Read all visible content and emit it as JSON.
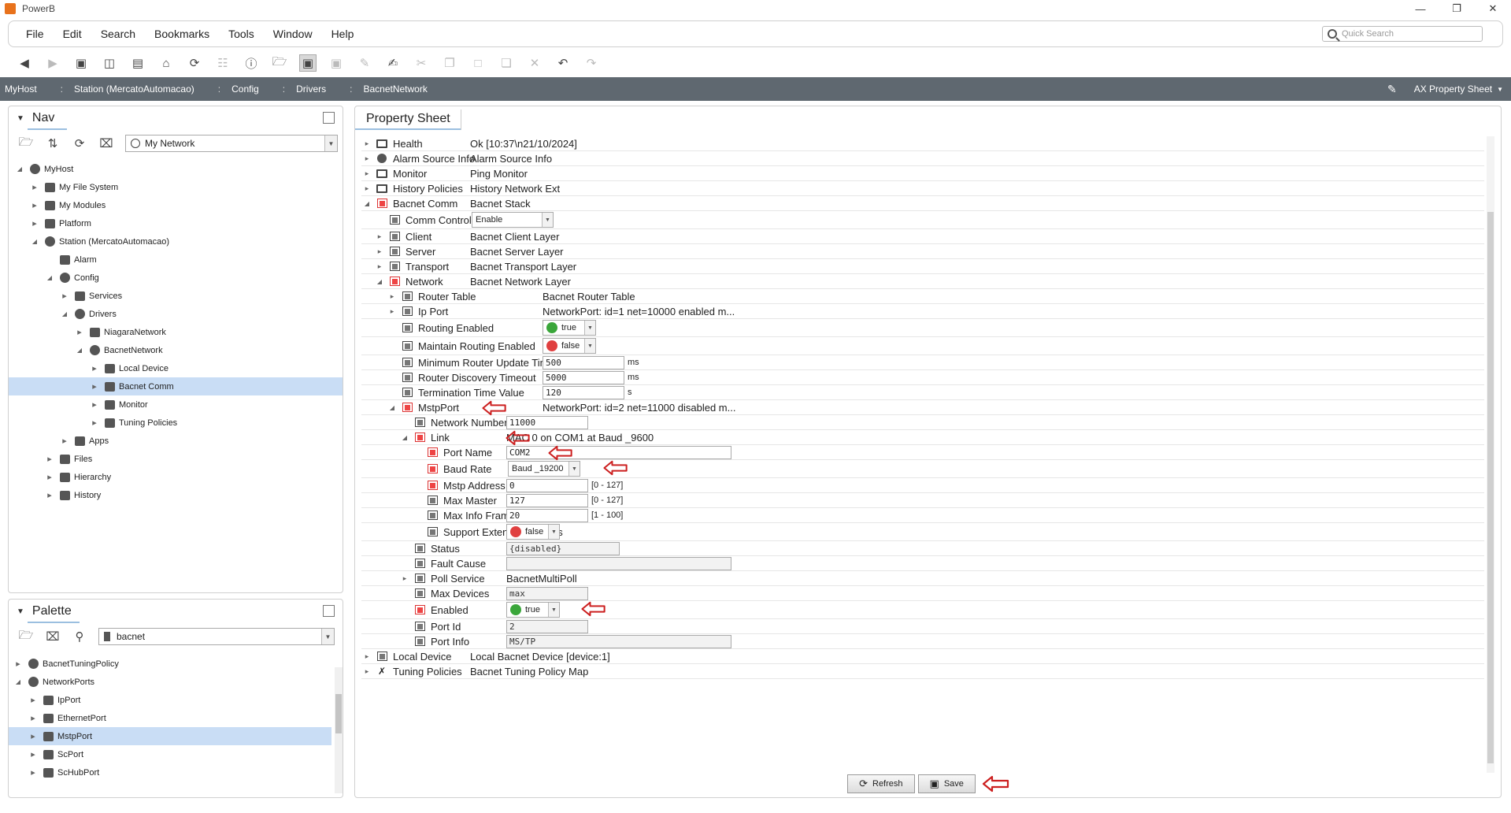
{
  "window": {
    "title": "PowerB"
  },
  "menu": [
    "File",
    "Edit",
    "Search",
    "Bookmarks",
    "Tools",
    "Window",
    "Help"
  ],
  "quick_search": {
    "placeholder": "Quick Search"
  },
  "path": {
    "crumbs": [
      "MyHost",
      "Station (MercatoAutomacao)",
      "Config",
      "Drivers",
      "BacnetNetwork"
    ],
    "view": "AX Property Sheet"
  },
  "nav": {
    "title": "Nav",
    "selector": "My Network",
    "tree": [
      {
        "label": "MyHost",
        "depth": 0,
        "state": "open"
      },
      {
        "label": "My File System",
        "depth": 1,
        "state": "closed"
      },
      {
        "label": "My Modules",
        "depth": 1,
        "state": "closed"
      },
      {
        "label": "Platform",
        "depth": 1,
        "state": "closed"
      },
      {
        "label": "Station (MercatoAutomacao)",
        "depth": 1,
        "state": "open"
      },
      {
        "label": "Alarm",
        "depth": 2,
        "state": "none"
      },
      {
        "label": "Config",
        "depth": 2,
        "state": "open"
      },
      {
        "label": "Services",
        "depth": 3,
        "state": "closed"
      },
      {
        "label": "Drivers",
        "depth": 3,
        "state": "open"
      },
      {
        "label": "NiagaraNetwork",
        "depth": 4,
        "state": "closed"
      },
      {
        "label": "BacnetNetwork",
        "depth": 4,
        "state": "open"
      },
      {
        "label": "Local Device",
        "depth": 5,
        "state": "closed"
      },
      {
        "label": "Bacnet Comm",
        "depth": 5,
        "state": "closed",
        "selected": true
      },
      {
        "label": "Monitor",
        "depth": 5,
        "state": "closed"
      },
      {
        "label": "Tuning Policies",
        "depth": 5,
        "state": "closed"
      },
      {
        "label": "Apps",
        "depth": 3,
        "state": "closed"
      },
      {
        "label": "Files",
        "depth": 2,
        "state": "closed"
      },
      {
        "label": "Hierarchy",
        "depth": 2,
        "state": "closed"
      },
      {
        "label": "History",
        "depth": 2,
        "state": "closed"
      }
    ]
  },
  "palette": {
    "title": "Palette",
    "selector": "bacnet",
    "tree": [
      {
        "label": "BacnetTuningPolicy",
        "depth": 0,
        "state": "closed"
      },
      {
        "label": "NetworkPorts",
        "depth": 0,
        "state": "open"
      },
      {
        "label": "IpPort",
        "depth": 1,
        "state": "closed"
      },
      {
        "label": "EthernetPort",
        "depth": 1,
        "state": "closed"
      },
      {
        "label": "MstpPort",
        "depth": 1,
        "state": "closed",
        "selected": true
      },
      {
        "label": "ScPort",
        "depth": 1,
        "state": "closed"
      },
      {
        "label": "ScHubPort",
        "depth": 1,
        "state": "closed"
      }
    ]
  },
  "sheet": {
    "tab": "Property Sheet",
    "rows": [
      {
        "name": "Health",
        "depth": 0,
        "state": "closed",
        "icon": "monitor",
        "value": "Ok [10:37\\n21/10/2024]"
      },
      {
        "name": "Alarm Source Info",
        "depth": 0,
        "state": "closed",
        "icon": "bell",
        "value": "Alarm Source Info"
      },
      {
        "name": "Monitor",
        "depth": 0,
        "state": "closed",
        "icon": "monitor",
        "value": "Ping Monitor"
      },
      {
        "name": "History Policies",
        "depth": 0,
        "state": "closed",
        "icon": "monitor",
        "value": "History Network Ext"
      },
      {
        "name": "Bacnet Comm",
        "depth": 0,
        "state": "open",
        "icon": "red",
        "value": "Bacnet Stack"
      },
      {
        "name": "Comm Control",
        "depth": 1,
        "state": "none",
        "icon": "slot",
        "enum": "Enable"
      },
      {
        "name": "Client",
        "depth": 1,
        "state": "closed",
        "icon": "slot",
        "value": "Bacnet Client Layer"
      },
      {
        "name": "Server",
        "depth": 1,
        "state": "closed",
        "icon": "slot",
        "value": "Bacnet Server Layer"
      },
      {
        "name": "Transport",
        "depth": 1,
        "state": "closed",
        "icon": "slot",
        "value": "Bacnet Transport Layer"
      },
      {
        "name": "Network",
        "depth": 1,
        "state": "open",
        "icon": "red",
        "value": "Bacnet Network Layer"
      },
      {
        "name": "Router Table",
        "depth": 2,
        "state": "closed",
        "icon": "slot",
        "value": "Bacnet Router Table"
      },
      {
        "name": "Ip Port",
        "depth": 2,
        "state": "closed",
        "icon": "slot",
        "value": "NetworkPort: id=1 net=10000 enabled m..."
      },
      {
        "name": "Routing Enabled",
        "depth": 2,
        "state": "none",
        "icon": "slot",
        "bool": "true",
        "color": "#3aa63a"
      },
      {
        "name": "Maintain Routing Enabled",
        "depth": 2,
        "state": "none",
        "icon": "slot",
        "bool": "false",
        "color": "#e04040"
      },
      {
        "name": "Minimum Router Update Time",
        "depth": 2,
        "state": "none",
        "icon": "slot",
        "field": "500",
        "unit": "ms"
      },
      {
        "name": "Router Discovery Timeout",
        "depth": 2,
        "state": "none",
        "icon": "slot",
        "field": "5000",
        "unit": "ms"
      },
      {
        "name": "Termination Time Value",
        "depth": 2,
        "state": "none",
        "icon": "slot",
        "field": "120",
        "unit": "s"
      },
      {
        "name": "MstpPort",
        "depth": 2,
        "state": "open",
        "icon": "red",
        "value": "NetworkPort: id=2 net=11000 disabled m...",
        "arrow": true
      },
      {
        "name": "Network Number",
        "depth": 3,
        "state": "none",
        "icon": "slot",
        "field": "11000"
      },
      {
        "name": "Link",
        "depth": 3,
        "state": "open",
        "icon": "red",
        "value": "MAC 0 on COM1 at Baud _9600",
        "arrow": true
      },
      {
        "name": "Port Name",
        "depth": 4,
        "state": "none",
        "icon": "red",
        "field": "COM2",
        "wide": true,
        "arrow": true
      },
      {
        "name": "Baud Rate",
        "depth": 4,
        "state": "none",
        "icon": "red",
        "enum": "Baud _19200",
        "arrow": true
      },
      {
        "name": "Mstp Address",
        "depth": 4,
        "state": "none",
        "icon": "red",
        "field": "0",
        "unit": "[0 - 127]"
      },
      {
        "name": "Max Master",
        "depth": 4,
        "state": "none",
        "icon": "slot",
        "field": "127",
        "unit": "[0 - 127]"
      },
      {
        "name": "Max Info Frames",
        "depth": 4,
        "state": "none",
        "icon": "slot",
        "field": "20",
        "unit": "[1 - 100]"
      },
      {
        "name": "Support Extended Frames",
        "depth": 4,
        "state": "none",
        "icon": "slot",
        "bool": "false",
        "color": "#e04040"
      },
      {
        "name": "Status",
        "depth": 3,
        "state": "none",
        "icon": "slot",
        "ro": "{disabled}"
      },
      {
        "name": "Fault Cause",
        "depth": 3,
        "state": "none",
        "icon": "slot",
        "ro": ""
      },
      {
        "name": "Poll Service",
        "depth": 3,
        "state": "closed",
        "icon": "slot",
        "value": "BacnetMultiPoll"
      },
      {
        "name": "Max Devices",
        "depth": 3,
        "state": "none",
        "icon": "slot",
        "ro": "max"
      },
      {
        "name": "Enabled",
        "depth": 3,
        "state": "none",
        "icon": "red",
        "bool": "true",
        "color": "#3aa63a",
        "arrow": true
      },
      {
        "name": "Port Id",
        "depth": 3,
        "state": "none",
        "icon": "slot",
        "ro": "2"
      },
      {
        "name": "Port Info",
        "depth": 3,
        "state": "none",
        "icon": "slot",
        "ro": "MS/TP"
      },
      {
        "name": "Local Device",
        "depth": 0,
        "state": "closed",
        "icon": "slot",
        "value": "Local Bacnet Device [device:1]"
      },
      {
        "name": "Tuning Policies",
        "depth": 0,
        "state": "closed",
        "icon": "tool",
        "value": "Bacnet Tuning Policy Map"
      }
    ]
  },
  "buttons": {
    "refresh": "Refresh",
    "save": "Save"
  },
  "colors": {
    "pathbar": "#5f6870",
    "selection": "#c9ddf5",
    "arrow": "#cc1f1f"
  }
}
